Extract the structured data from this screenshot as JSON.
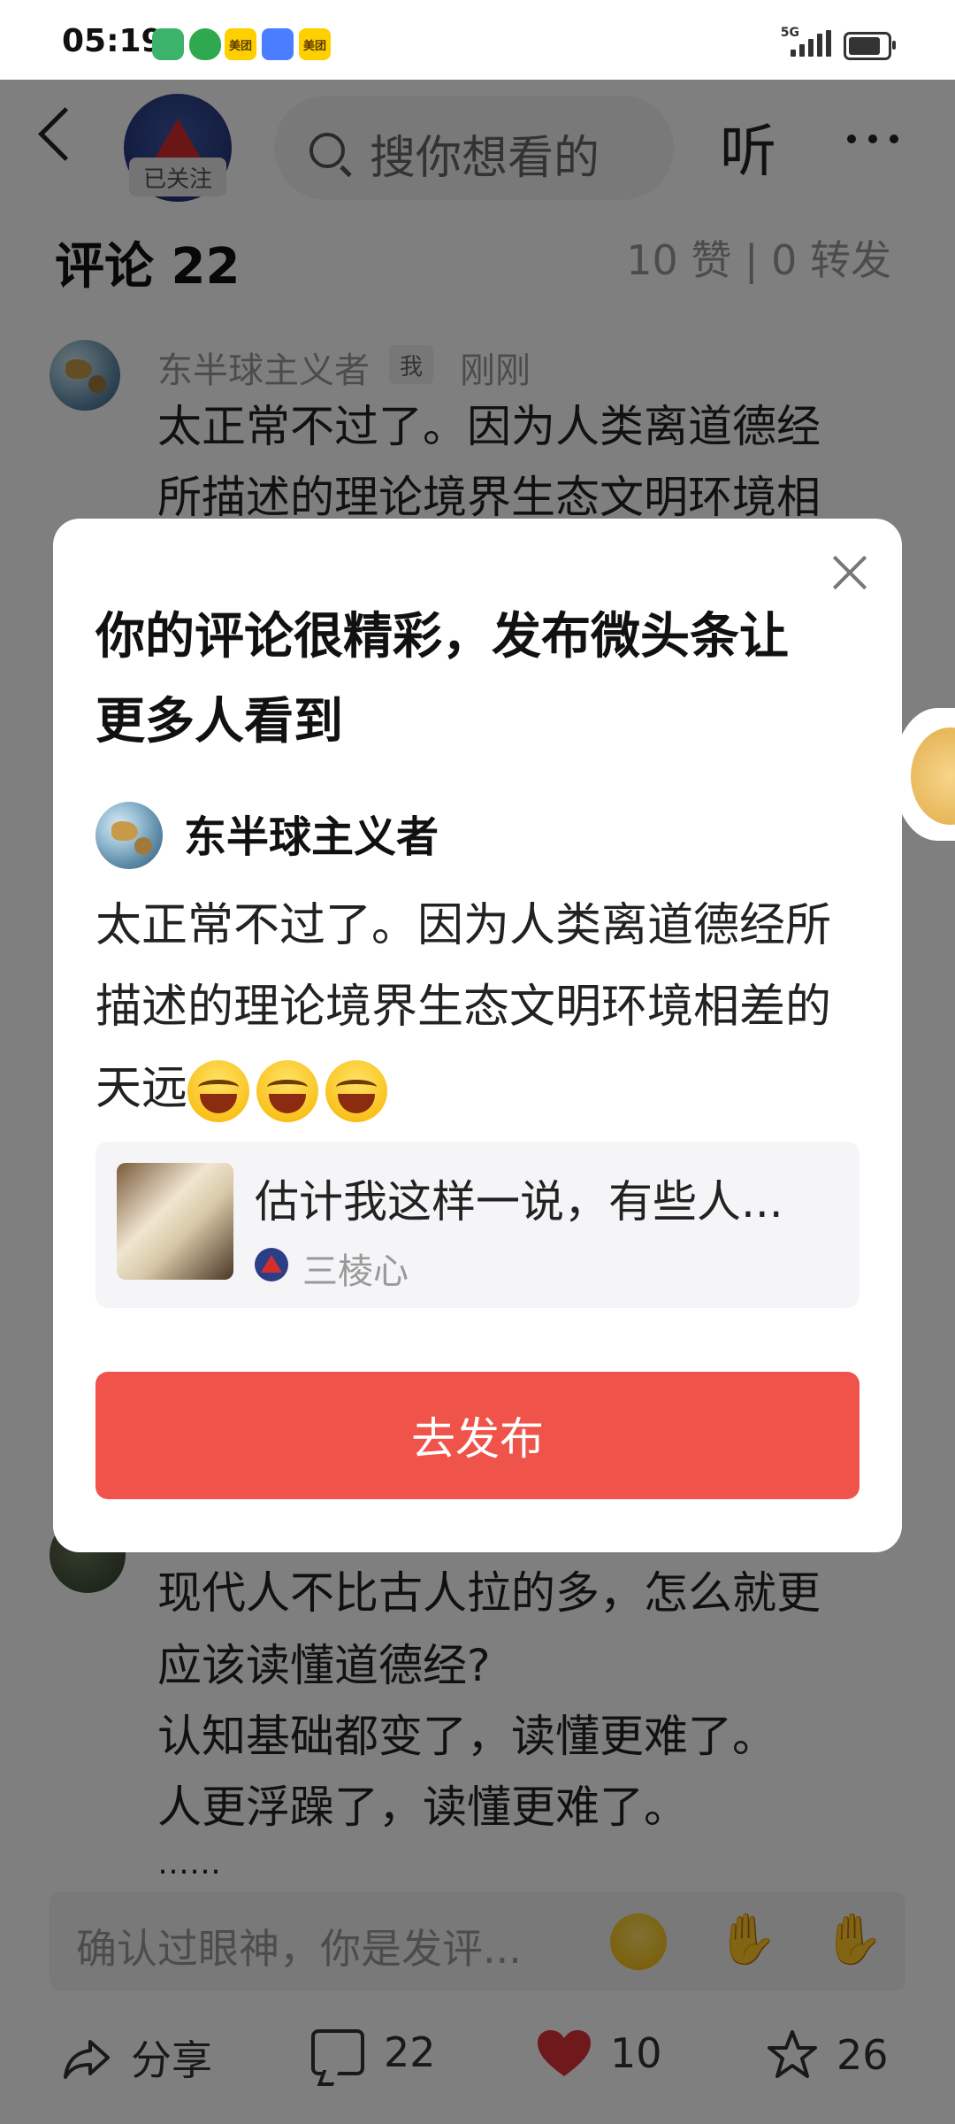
{
  "status_bar": {
    "time": "05:19",
    "network": "5G",
    "apps": [
      {
        "name": "green-swirl-app-icon",
        "label": "",
        "color": "#3bb36b"
      },
      {
        "name": "shield-app-icon",
        "label": "",
        "color": "#2fa84f"
      },
      {
        "name": "meituan-app-icon",
        "label": "美团",
        "color": "#ffd000"
      },
      {
        "name": "blue-app-icon",
        "label": "",
        "color": "#4a7dff"
      },
      {
        "name": "meituan-app-icon-2",
        "label": "美团",
        "color": "#ffd000"
      }
    ],
    "battery_level": 0.75
  },
  "header": {
    "follow_label": "已关注",
    "search_placeholder": "搜你想看的",
    "listen_label": "听"
  },
  "comments_section": {
    "title": "评论 22",
    "likes_text": "10 赞 | 0 转发",
    "first_comment": {
      "user": "东半球主义者",
      "badge": "我",
      "time": "刚刚",
      "text_line1": "太正常不过了。因为人类离道德经",
      "text_line2": "所描述的理论境界生态文明环境相"
    },
    "second_comment": {
      "line1": "现代人不比古人拉的多，怎么就更",
      "line2": "应该读懂道德经?",
      "line3": "认知基础都变了，读懂更难了。",
      "line4": "人更浮躁了，读懂更难了。",
      "line5": "……"
    }
  },
  "comment_input": {
    "placeholder": "确认过眼神，你是发评..."
  },
  "toolbar": {
    "share_label": "分享",
    "comments_count": "22",
    "likes_count": "10",
    "favorites_count": "26"
  },
  "modal": {
    "title_line1": "你的评论很精彩，发布微头条让",
    "title_line2": "更多人看到",
    "user": "东半球主义者",
    "text_line1": "太正常不过了。因为人类离道德经所",
    "text_line2": "描述的理论境界生态文明环境相差的",
    "text_line3": "天远",
    "article_title": "估计我这样一说，有些人...",
    "article_author": "三棱心",
    "publish_label": "去发布"
  },
  "colors": {
    "accent": "#f0534a",
    "like_heart": "#e0323a"
  }
}
